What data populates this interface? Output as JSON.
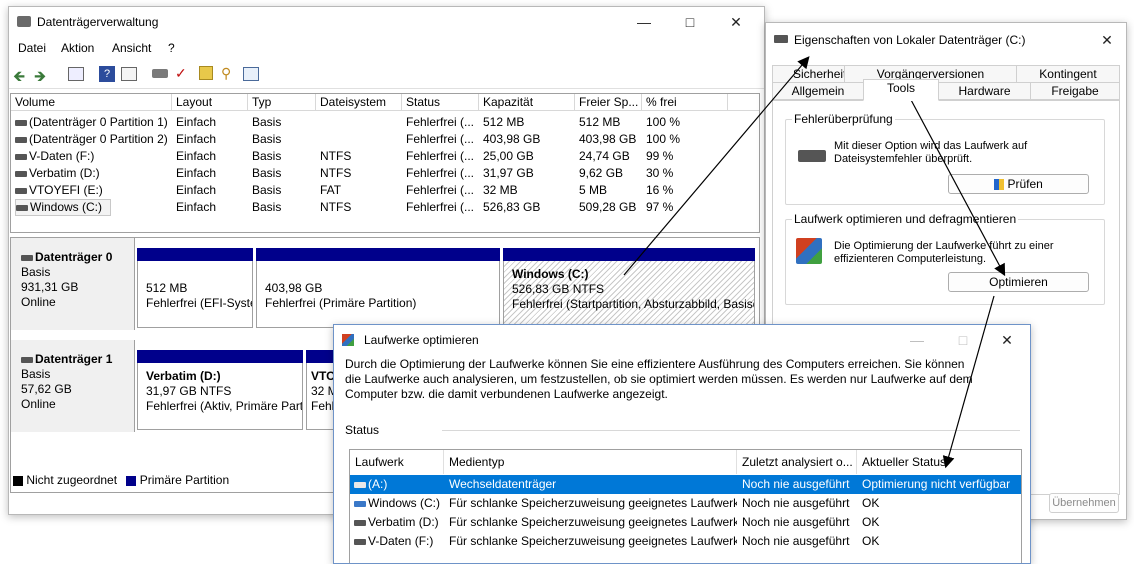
{
  "disk_mgmt": {
    "title": "Datenträgerverwaltung",
    "menu": [
      "Datei",
      "Aktion",
      "Ansicht",
      "?"
    ],
    "columns": [
      "Volume",
      "Layout",
      "Typ",
      "Dateisystem",
      "Status",
      "Kapazität",
      "Freier Sp...",
      "% frei"
    ],
    "volumes": [
      {
        "name": "(Datenträger 0 Partition 1)",
        "layout": "Einfach",
        "type": "Basis",
        "fs": "",
        "status": "Fehlerfrei (...",
        "capacity": "512 MB",
        "free": "512 MB",
        "pct": "100 %"
      },
      {
        "name": "(Datenträger 0 Partition 2)",
        "layout": "Einfach",
        "type": "Basis",
        "fs": "",
        "status": "Fehlerfrei (...",
        "capacity": "403,98 GB",
        "free": "403,98 GB",
        "pct": "100 %"
      },
      {
        "name": "V-Daten (F:)",
        "layout": "Einfach",
        "type": "Basis",
        "fs": "NTFS",
        "status": "Fehlerfrei (...",
        "capacity": "25,00 GB",
        "free": "24,74 GB",
        "pct": "99 %"
      },
      {
        "name": "Verbatim (D:)",
        "layout": "Einfach",
        "type": "Basis",
        "fs": "NTFS",
        "status": "Fehlerfrei (...",
        "capacity": "31,97 GB",
        "free": "9,62 GB",
        "pct": "30 %"
      },
      {
        "name": "VTOYEFI (E:)",
        "layout": "Einfach",
        "type": "Basis",
        "fs": "FAT",
        "status": "Fehlerfrei (...",
        "capacity": "32 MB",
        "free": "5 MB",
        "pct": "16 %"
      },
      {
        "name": "Windows (C:)",
        "layout": "Einfach",
        "type": "Basis",
        "fs": "NTFS",
        "status": "Fehlerfrei (...",
        "capacity": "526,83 GB",
        "free": "509,28 GB",
        "pct": "97 %"
      }
    ],
    "disk0": {
      "name": "Datenträger 0",
      "type": "Basis",
      "size": "931,31 GB",
      "state": "Online",
      "p1": {
        "size": "512 MB",
        "status": "Fehlerfrei (EFI-Syste"
      },
      "p2": {
        "size": "403,98 GB",
        "status": "Fehlerfrei (Primäre Partition)"
      },
      "p3": {
        "name": "Windows (C:)",
        "size": "526,83 GB NTFS",
        "status": "Fehlerfrei (Startpartition, Absturzabbild, Basisd"
      }
    },
    "disk1": {
      "name": "Datenträger 1",
      "type": "Basis",
      "size": "57,62 GB",
      "state": "Online",
      "p1": {
        "name": "Verbatim (D:)",
        "size": "31,97 GB NTFS",
        "status": "Fehlerfrei (Aktiv, Primäre Part"
      },
      "p2": {
        "name": "VTO",
        "size": "32 M",
        "status": "Fehl"
      }
    },
    "legend": {
      "unallocated": "Nicht zugeordnet",
      "primary": "Primäre Partition"
    }
  },
  "props": {
    "title": "Eigenschaften von Lokaler Datenträger (C:)",
    "tabs_row1": [
      "Sicherheit",
      "Vorgängerversionen",
      "Kontingent"
    ],
    "tabs_row2": [
      "Allgemein",
      "Tools",
      "Hardware",
      "Freigabe"
    ],
    "error_group": {
      "label": "Fehlerüberprüfung",
      "text": "Mit dieser Option wird das Laufwerk auf Dateisystemfehler überprüft.",
      "button": "Prüfen"
    },
    "optimize_group": {
      "label": "Laufwerk optimieren und defragmentieren",
      "text": "Die Optimierung der Laufwerke führt zu einer effizienteren Computerleistung.",
      "button": "Optimieren"
    },
    "apply_button": "Übernehmen"
  },
  "optimize": {
    "title": "Laufwerke optimieren",
    "description": "Durch die Optimierung der Laufwerke können Sie eine effizientere Ausführung des Computers erreichen. Sie können die Laufwerke auch analysieren, um festzustellen, ob sie optimiert werden müssen. Es werden nur Laufwerke auf dem Computer bzw. die damit verbundenen Laufwerke angezeigt.",
    "status_label": "Status",
    "columns": [
      "Laufwerk",
      "Medientyp",
      "Zuletzt analysiert o...",
      "Aktueller Status"
    ],
    "rows": [
      {
        "drive": "(A:)",
        "media": "Wechseldatenträger",
        "last": "Noch nie ausgeführt",
        "status": "Optimierung nicht verfügbar"
      },
      {
        "drive": "Windows (C:)",
        "media": "Für schlanke Speicherzuweisung geeignetes Laufwerk",
        "last": "Noch nie ausgeführt",
        "status": "OK"
      },
      {
        "drive": "Verbatim (D:)",
        "media": "Für schlanke Speicherzuweisung geeignetes Laufwerk",
        "last": "Noch nie ausgeführt",
        "status": "OK"
      },
      {
        "drive": "V-Daten (F:)",
        "media": "Für schlanke Speicherzuweisung geeignetes Laufwerk",
        "last": "Noch nie ausgeführt",
        "status": "OK"
      }
    ]
  },
  "colors": {
    "primary_partition": "#00008b",
    "selection": "#0078d7"
  }
}
